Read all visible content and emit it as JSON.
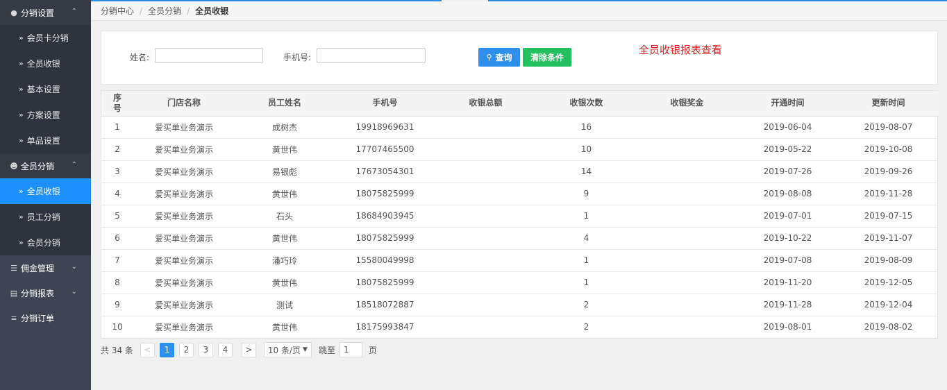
{
  "sidebar": {
    "groups": [
      {
        "label": "分销设置",
        "icon": "users-icon",
        "chev": "^",
        "open": true
      },
      {
        "label": "全员分销",
        "icon": "user-icon",
        "chev": "^",
        "open": true
      },
      {
        "label": "佣金管理",
        "icon": "database-icon",
        "chev": "v"
      },
      {
        "label": "分销报表",
        "icon": "report-icon",
        "chev": "v"
      },
      {
        "label": "分销订单",
        "icon": "list-icon"
      }
    ],
    "settings_items": [
      "会员卡分销",
      "全员收银",
      "基本设置",
      "方案设置",
      "单品设置"
    ],
    "all_items": [
      "全员收银",
      "员工分销",
      "会员分销"
    ],
    "active_item": "全员收银"
  },
  "breadcrumb": [
    "分销中心",
    "全员分销",
    "全员收银"
  ],
  "search": {
    "name_label": "姓名:",
    "name_value": "",
    "phone_label": "手机号:",
    "phone_value": "",
    "query_button": "查询",
    "clear_button": "清除条件",
    "note": "全员收银报表查看"
  },
  "table": {
    "headers": [
      "序号",
      "门店名称",
      "员工姓名",
      "手机号",
      "收银总额",
      "收银次数",
      "收银奖金",
      "开通时间",
      "更新时间"
    ],
    "rows": [
      [
        "1",
        "爱买单业务演示",
        "成树杰",
        "19918969631",
        "",
        "16",
        "",
        "2019-06-04",
        "2019-08-07"
      ],
      [
        "2",
        "爱买单业务演示",
        "黄世伟",
        "17707465500",
        "",
        "10",
        "",
        "2019-05-22",
        "2019-10-08"
      ],
      [
        "3",
        "爱买单业务演示",
        "易银彪",
        "17673054301",
        "",
        "14",
        "",
        "2019-07-26",
        "2019-09-26"
      ],
      [
        "4",
        "爱买单业务演示",
        "黄世伟",
        "18075825999",
        "",
        "9",
        "",
        "2019-08-08",
        "2019-11-28"
      ],
      [
        "5",
        "爱买单业务演示",
        "石头",
        "18684903945",
        "",
        "1",
        "",
        "2019-07-01",
        "2019-07-15"
      ],
      [
        "6",
        "爱买单业务演示",
        "黄世伟",
        "18075825999",
        "",
        "4",
        "",
        "2019-10-22",
        "2019-11-07"
      ],
      [
        "7",
        "爱买单业务演示",
        "潘巧玲",
        "15580049998",
        "",
        "1",
        "",
        "2019-07-08",
        "2019-08-09"
      ],
      [
        "8",
        "爱买单业务演示",
        "黄世伟",
        "18075825999",
        "",
        "1",
        "",
        "2019-11-20",
        "2019-12-05"
      ],
      [
        "9",
        "爱买单业务演示",
        "测试",
        "18518072887",
        "",
        "2",
        "",
        "2019-11-28",
        "2019-12-04"
      ],
      [
        "10",
        "爱买单业务演示",
        "黄世伟",
        "18175993847",
        "",
        "2",
        "",
        "2019-08-01",
        "2019-08-02"
      ]
    ]
  },
  "pager": {
    "total": "共 34 条",
    "prev": "<",
    "pages": [
      "1",
      "2",
      "3",
      "4"
    ],
    "current": "1",
    "next": ">",
    "page_size": "10 条/页",
    "jump_label": "跳至",
    "jump_value": "1",
    "page_unit": "页"
  },
  "colors": {
    "sidebar_bg": "#3f4452",
    "active": "#1e90ff",
    "query_button": "#2f8fed",
    "clear_button": "#22c05e",
    "note": "#e02020"
  }
}
